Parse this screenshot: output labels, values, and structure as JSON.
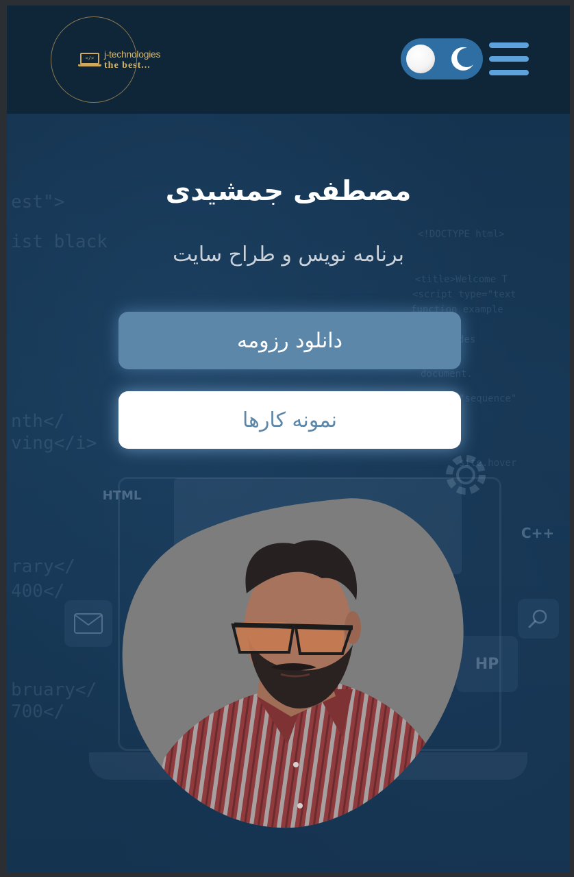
{
  "header": {
    "logo": {
      "name": "j-technologies",
      "tagline": "the best...",
      "laptop_glyph": "</>"
    },
    "theme_toggle": {
      "mode": "dark",
      "knob_icon": "sun-circle-icon",
      "moon_icon": "moon-icon"
    },
    "menu_icon": "hamburger-icon"
  },
  "hero": {
    "name": "مصطفی جمشیدی",
    "role": "برنامه نویس و طراح سایت",
    "resume_button": "دانلود رزومه",
    "portfolio_button": "نمونه کارها"
  },
  "background": {
    "code_lines": [
      "est\">",
      "ist black",
      "nth</",
      "ving</i>",
      "rary</",
      "400</",
      "bruary</",
      "700</",
      "<!DOCTYPE html>",
      "<title>Welcome T",
      "<script type=\"text",
      "function example",
      "var slides",
      "document.",
      "site.hover",
      "\"sequence\""
    ],
    "ghost_labels": [
      "HTML",
      "HP",
      "C++"
    ]
  },
  "colors": {
    "page_bg": "#13314d",
    "header_bg": "#0f2538",
    "toggle_bg": "#2f6ea3",
    "hamburger": "#5da2dd",
    "logo_gold": "#d6b56a",
    "resume_btn": "#5d87a8",
    "portfolio_btn": "#ffffff"
  }
}
